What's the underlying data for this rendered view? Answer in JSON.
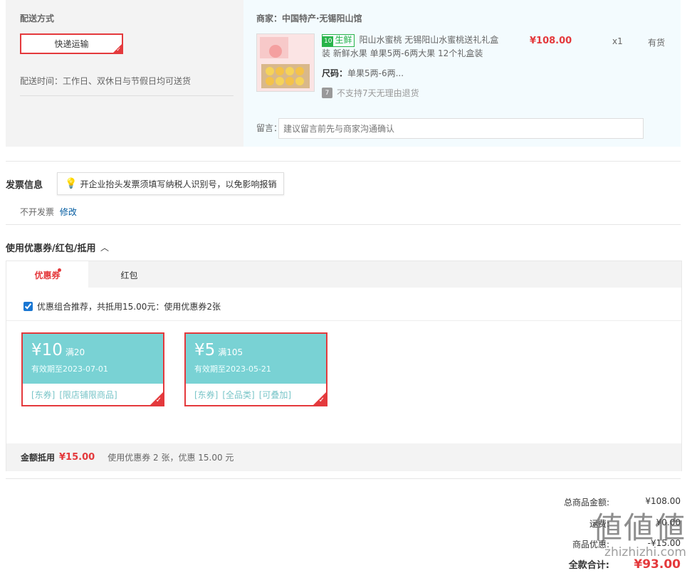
{
  "shipping": {
    "title": "配送方式",
    "method": "快递运输",
    "time_text": "配送时间：工作日、双休日与节假日均可送货"
  },
  "merchant": {
    "label": "商家：中国特产·无锡阳山馆"
  },
  "product": {
    "tag": "生鲜",
    "name": "阳山水蜜桃 无锡阳山水蜜桃送礼礼盒装 新鲜水果 单果5两-6两大果 12个礼盒装",
    "size_label": "尺码：",
    "size_value": "单果5两-6两...",
    "return_icon": "7",
    "return_text": "不支持7天无理由退货",
    "price": "¥108.00",
    "qty": "x1",
    "stock": "有货"
  },
  "message": {
    "label": "留言：",
    "placeholder": "建议留言前先与商家沟通确认"
  },
  "invoice": {
    "title": "发票信息",
    "tip": "开企业抬头发票须填写纳税人识别号，以免影响报销",
    "value": "不开发票",
    "edit": "修改"
  },
  "coupons": {
    "title": "使用优惠券/红包/抵用",
    "tabs": [
      "优惠券",
      "红包"
    ],
    "combo_text": "优惠组合推荐，共抵用15.00元：使用优惠券2张",
    "items": [
      {
        "amount": "¥10",
        "cond": "满20",
        "valid": "有效期至2023-07-01",
        "tags": [
          "[东券]",
          "[限店铺限商品]"
        ]
      },
      {
        "amount": "¥5",
        "cond": "满105",
        "valid": "有效期至2023-05-21",
        "tags": [
          "[东券]",
          "[全品类]",
          "[可叠加]"
        ]
      }
    ],
    "footer_label": "金额抵用",
    "footer_amount": "¥15.00",
    "footer_desc": "使用优惠券 2 张，优惠 15.00 元"
  },
  "summary": {
    "rows": [
      {
        "label": "总商品金额:",
        "value": "¥108.00"
      },
      {
        "label": "运费:",
        "value": "¥0.00"
      },
      {
        "label": "商品优惠:",
        "value": "-¥15.00"
      }
    ],
    "total_label": "全款合计:",
    "total_value": "¥93.00"
  },
  "watermark": {
    "glyphs": "値値値",
    "url": "zhizhizhi.com"
  },
  "colors": {
    "accent": "#e4393c",
    "coupon_teal": "#79d2d4",
    "fresh_green": "#28b44a",
    "link_blue": "#005aa0"
  }
}
